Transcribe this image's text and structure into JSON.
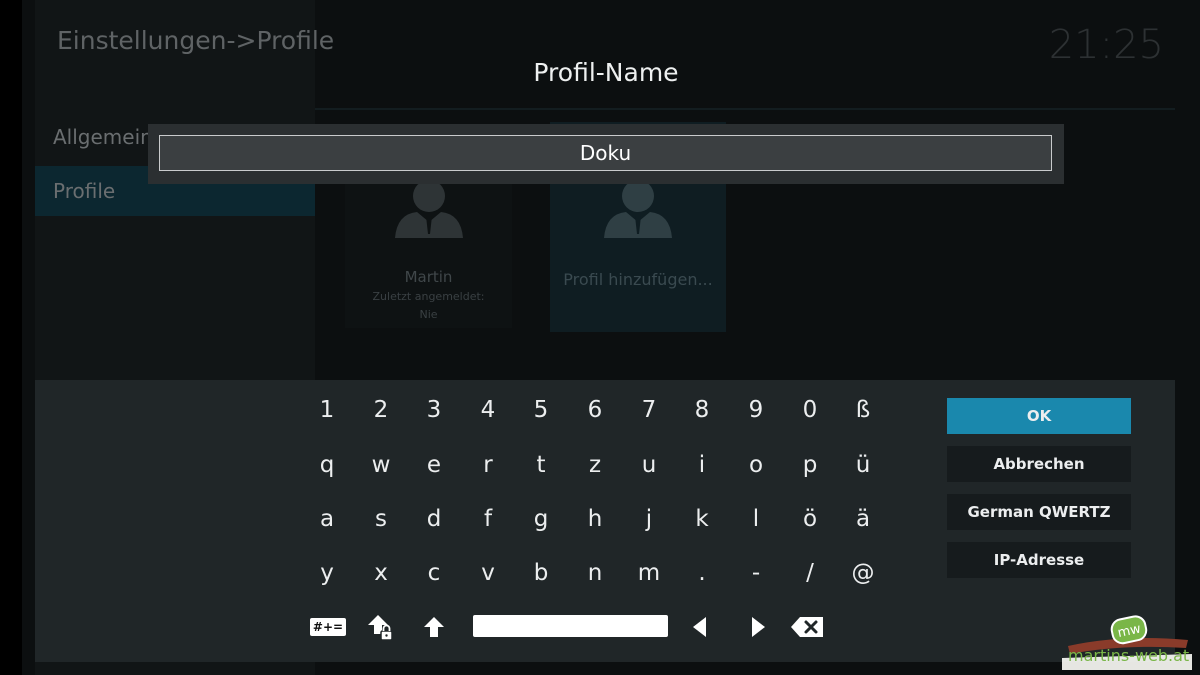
{
  "background": {
    "window_title": "Einstellungen->Profile",
    "clock": "21:25",
    "sidebar": [
      {
        "label": "Allgemein"
      },
      {
        "label": "Profile"
      }
    ],
    "profiles": [
      {
        "name": "Martin",
        "last_login_label": "Zuletzt angemeldet:",
        "last_login_value": "Nie"
      },
      {
        "name": "Profil hinzufügen..."
      }
    ]
  },
  "dialog": {
    "title": "Profil-Name",
    "input_value": "Doku"
  },
  "keyboard": {
    "rows": [
      [
        "1",
        "2",
        "3",
        "4",
        "5",
        "6",
        "7",
        "8",
        "9",
        "0",
        "ß"
      ],
      [
        "q",
        "w",
        "e",
        "r",
        "t",
        "z",
        "u",
        "i",
        "o",
        "p",
        "ü"
      ],
      [
        "a",
        "s",
        "d",
        "f",
        "g",
        "h",
        "j",
        "k",
        "l",
        "ö",
        "ä"
      ],
      [
        "y",
        "x",
        "c",
        "v",
        "b",
        "n",
        "m",
        ".",
        "-",
        "/",
        "@"
      ]
    ],
    "symbols_label": "#+=",
    "buttons": {
      "ok": "OK",
      "cancel": "Abbrechen",
      "layout": "German QWERTZ",
      "ip": "IP-Adresse"
    },
    "accent_color": "#1a88ad"
  },
  "watermark": {
    "logo_letters": "mw",
    "text": "martins-web.at"
  }
}
